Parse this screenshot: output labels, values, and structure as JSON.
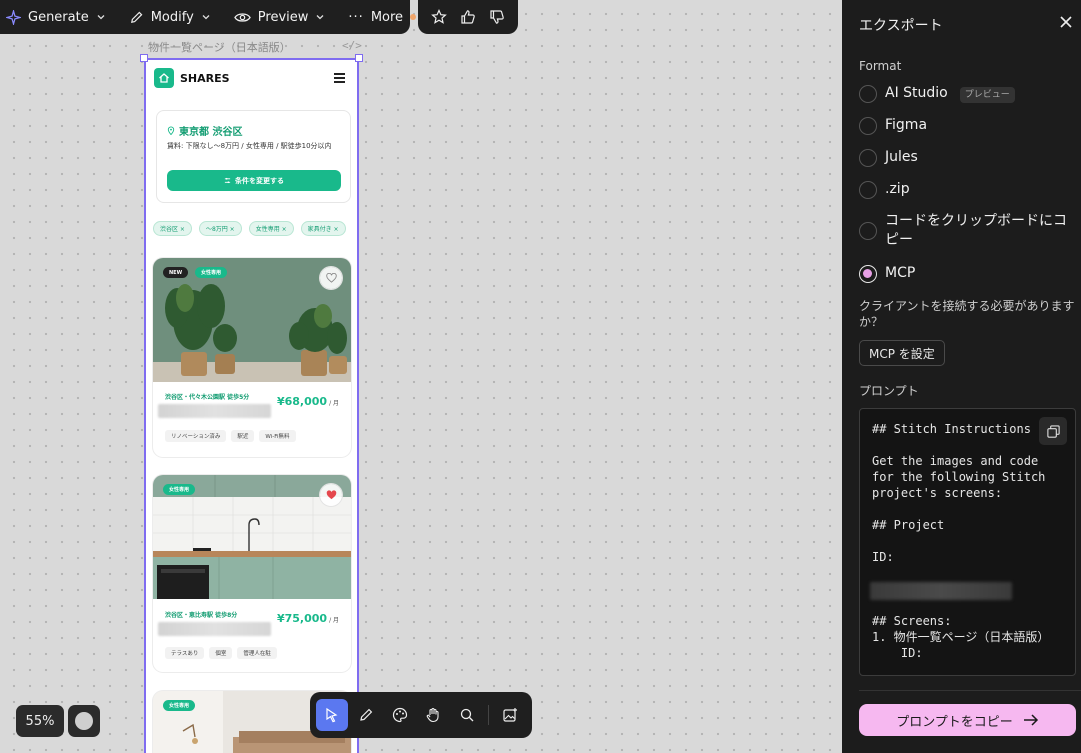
{
  "toolbar": {
    "generate_label": "Generate",
    "modify_label": "Modify",
    "preview_label": "Preview",
    "more_label": "More",
    "more_dot_color": "#f0a56a"
  },
  "canvas": {
    "frame_label": "物件一覧ページ（日本語版）",
    "frame_code_icon": "</>",
    "zoom_label": "55%"
  },
  "phone": {
    "brand": "SHARES",
    "location": "東京都 渋谷区",
    "conditions": "賃料: 下限なし〜8万円 / 女性専用 / 駅徒歩10分以内",
    "change_button": "条件を変更する",
    "filter_chips": [
      "渋谷区 ×",
      "〜8万円 ×",
      "女性専用 ×",
      "家具付き ×"
    ],
    "cards": [
      {
        "badges": [
          "NEW",
          "女性専用"
        ],
        "station": "渋谷区・代々木公園駅 徒歩5分",
        "price": "¥68,000",
        "unit": "/ 月",
        "amenities": [
          "リノベーション済み",
          "駅近",
          "Wi-Fi無料"
        ],
        "favorited": false
      },
      {
        "badges": [
          "女性専用"
        ],
        "station": "渋谷区・恵比寿駅 徒歩8分",
        "price": "¥75,000",
        "unit": "/ 月",
        "amenities": [
          "テラスあり",
          "個室",
          "管理人在駐"
        ],
        "favorited": true
      },
      {
        "badges": [
          "女性専用"
        ]
      }
    ]
  },
  "export_panel": {
    "title": "エクスポート",
    "format_label": "Format",
    "options": [
      {
        "label": "AI Studio",
        "badge": "プレビュー",
        "selected": false
      },
      {
        "label": "Figma",
        "selected": false
      },
      {
        "label": "Jules",
        "selected": false
      },
      {
        "label": ".zip",
        "selected": false
      },
      {
        "label": "コードをクリップボードにコピー",
        "selected": false
      },
      {
        "label": "MCP",
        "selected": true
      }
    ],
    "client_hint": "クライアントを接続する必要がありますか？",
    "mcp_button": "MCP を設定",
    "prompt_label": "プロンプト",
    "prompt_text_top": "## Stitch Instructions\n\nGet the images and code for the following Stitch project's screens:\n\n## Project\n\nID:",
    "prompt_text_bottom": "## Screens:\n1. 物件一覧ページ（日本語版）\n    ID:",
    "copy_prompt_button": "プロンプトをコピー",
    "accent_color": "#f6b8f0"
  }
}
